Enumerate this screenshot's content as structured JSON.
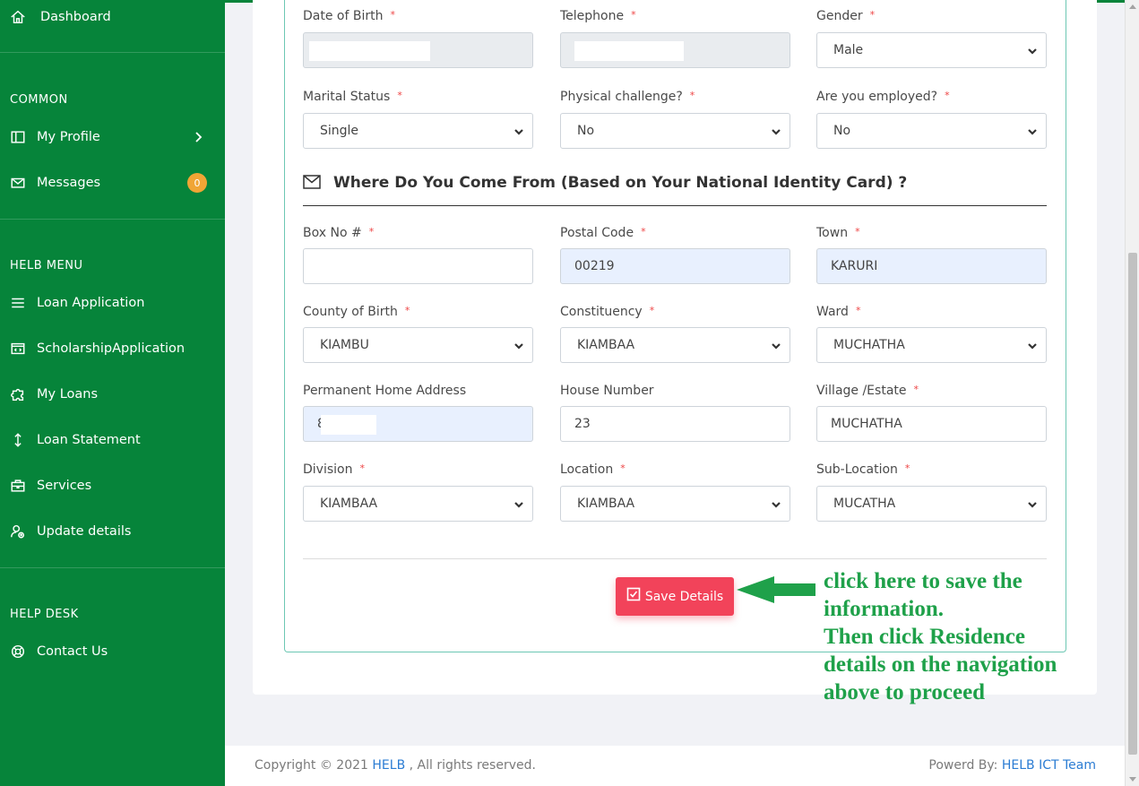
{
  "sidebar": {
    "dashboard": "Dashboard",
    "common_heading": "COMMON",
    "my_profile": "My Profile",
    "messages": "Messages",
    "messages_count": "0",
    "helb_menu_heading": "HELB MENU",
    "loan_application": "Loan Application",
    "scholarship_application": "ScholarshipApplication",
    "my_loans": "My Loans",
    "loan_statement": "Loan Statement",
    "services": "Services",
    "update_details": "Update details",
    "help_desk_heading": "HELP DESK",
    "contact_us": "Contact Us"
  },
  "personal": {
    "dob_label": "Date of Birth",
    "telephone_label": "Telephone",
    "gender_label": "Gender",
    "gender_value": "Male",
    "marital_label": "Marital Status",
    "marital_value": "Single",
    "physical_label": "Physical challenge?",
    "physical_value": "No",
    "employed_label": "Are you employed?",
    "employed_value": "No",
    "required_mark": "*"
  },
  "origin": {
    "section_title": "Where Do You Come From (Based on Your National Identity Card) ?",
    "box_label": "Box No #",
    "box_value": "",
    "postal_label": "Postal Code",
    "postal_value": "00219",
    "town_label": "Town",
    "town_value": "KARURI",
    "county_label": "County of Birth",
    "county_value": "KIAMBU",
    "constituency_label": "Constituency",
    "constituency_value": "KIAMBAA",
    "ward_label": "Ward",
    "ward_value": "MUCHATHA",
    "address_label": "Permanent Home Address",
    "address_value": "8",
    "house_label": "House Number",
    "house_value": "23",
    "village_label": "Village /Estate",
    "village_value": "MUCHATHA",
    "division_label": "Division",
    "division_value": "KIAMBAA",
    "location_label": "Location",
    "location_value": "KIAMBAA",
    "sublocation_label": "Sub-Location",
    "sublocation_value": "MUCATHA"
  },
  "actions": {
    "save_label": "Save Details"
  },
  "annotation": {
    "line1": "click here to save the",
    "line2": "information.",
    "line3": "Then click Residence",
    "line4": "details on the navigation",
    "line5": "above to proceed",
    "color": "#1fa14a"
  },
  "footer": {
    "copyright_prefix": "Copyright © 2021",
    "copyright_link": "HELB",
    "copyright_suffix": ", All rights reserved.",
    "powered_prefix": "Powerd By:",
    "powered_link": "HELB ICT Team"
  },
  "colors": {
    "sidebar": "#06843a",
    "save_button": "#f2435a",
    "badge": "#f0a535",
    "link": "#2b7cd3"
  },
  "icons": {
    "dashboard": "home-icon",
    "my_profile": "columns-icon",
    "messages": "mail-icon",
    "loan_application": "menu-icon",
    "scholarship_application": "code-window-icon",
    "my_loans": "puzzle-icon",
    "loan_statement": "arrows-vertical-icon",
    "services": "briefcase-icon",
    "update_details": "user-settings-icon",
    "contact_us": "lifebuoy-icon"
  }
}
